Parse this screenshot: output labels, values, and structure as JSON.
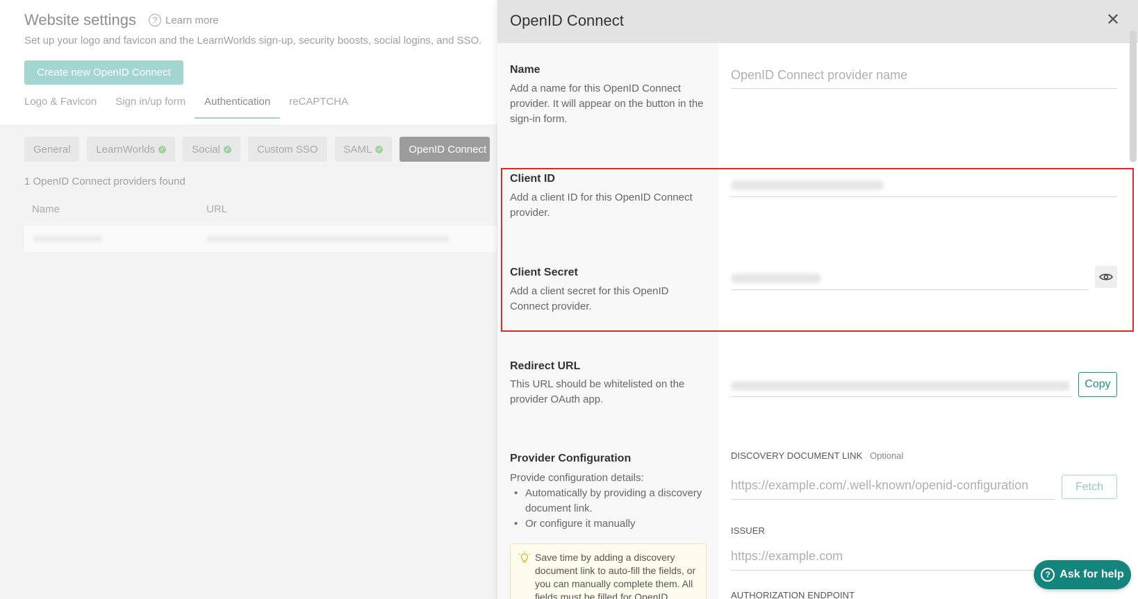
{
  "background": {
    "title": "Website settings",
    "learn_more": "Learn more",
    "subtitle": "Set up your logo and favicon and the LearnWorlds sign-up, security boosts, social logins, and SSO.",
    "create_button": "Create new OpenID Connect",
    "tabs": [
      "Logo & Favicon",
      "Sign in/up form",
      "Authentication",
      "reCAPTCHA"
    ],
    "active_tab": "Authentication",
    "pills": [
      {
        "label": "General",
        "checked": false
      },
      {
        "label": "LearnWorlds",
        "checked": true
      },
      {
        "label": "Social",
        "checked": true
      },
      {
        "label": "Custom SSO",
        "checked": false
      },
      {
        "label": "SAML",
        "checked": true
      },
      {
        "label": "OpenID Connect",
        "checked": false
      }
    ],
    "found_text": "1 OpenID Connect providers found",
    "columns": {
      "name": "Name",
      "url": "URL"
    }
  },
  "panel": {
    "title": "OpenID Connect",
    "close_symbol": "✕",
    "name": {
      "title": "Name",
      "description": "Add a name for this OpenID Connect provider. It will appear on the button in the sign-in form.",
      "placeholder": "OpenID Connect provider name"
    },
    "client_id": {
      "title": "Client ID",
      "description": "Add a client ID for this OpenID Connect provider."
    },
    "client_secret": {
      "title": "Client Secret",
      "description": "Add a client secret for this OpenID Connect provider."
    },
    "redirect_url": {
      "title": "Redirect URL",
      "description": "This URL should be whitelisted on the provider OAuth app.",
      "copy_label": "Copy"
    },
    "provider_config": {
      "title": "Provider Configuration",
      "description": "Provide configuration details:",
      "bullets": [
        "Automatically by providing a discovery document link.",
        "Or configure it manually"
      ],
      "tip": "Save time by adding a discovery document link to auto-fill the fields, or you can manually complete them. All fields must be filled for OpenID"
    },
    "discovery": {
      "label": "DISCOVERY DOCUMENT LINK",
      "optional": "Optional",
      "placeholder": "https://example.com/.well-known/openid-configuration",
      "fetch_label": "Fetch"
    },
    "issuer": {
      "label": "ISSUER",
      "placeholder": "https://example.com"
    },
    "authorization": {
      "label": "AUTHORIZATION ENDPOINT"
    }
  },
  "help_button": {
    "label": "Ask for help",
    "icon_symbol": "?"
  },
  "colors": {
    "accent": "#14857d",
    "highlight": "#e0262b"
  }
}
